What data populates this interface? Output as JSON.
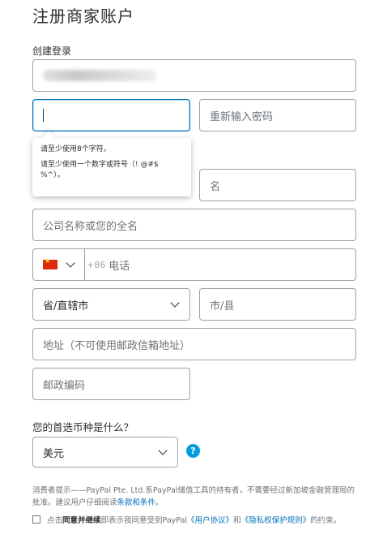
{
  "page": {
    "title": "注册商家账户",
    "section_label": "创建登录"
  },
  "login": {
    "password_placeholder": "",
    "confirm_password_placeholder": "重新输入密码"
  },
  "tooltip": {
    "line1": "请至少使用8个字符。",
    "line2": "请至少使用一个数字或符号（! @#$ %^）。"
  },
  "name": {
    "last_name_placeholder": "名"
  },
  "business": {
    "company_placeholder": "公司名称或您的全名",
    "phone_prefix": "+86",
    "phone_placeholder": "电话",
    "province_value": "省/直辖市",
    "city_placeholder": "市/县",
    "address_placeholder": "地址（不可使用邮政信箱地址）",
    "postal_placeholder": "邮政编码"
  },
  "currency": {
    "question": "您的首选币种是什么？",
    "value": "美元",
    "help_label": "?"
  },
  "footer": {
    "notice_text": "消费者提示——PayPal Pte. Ltd.系PayPal储值工具的持有者，不需要经过新加坡金融管理局的批准。建议用户仔细阅读",
    "notice_link": "条款和条件",
    "notice_end": "。",
    "agree_prefix": "点击",
    "agree_bold": "同意并继续",
    "agree_mid": "即表示我同意受到PayPal",
    "agree_link1": "《用户协议》",
    "agree_and": "和",
    "agree_link2": "《隐私权保护规则》",
    "agree_suffix": "的约束。"
  },
  "colors": {
    "accent": "#0070ba",
    "help_icon": "#009cde",
    "field_border": "#9da3a6"
  }
}
